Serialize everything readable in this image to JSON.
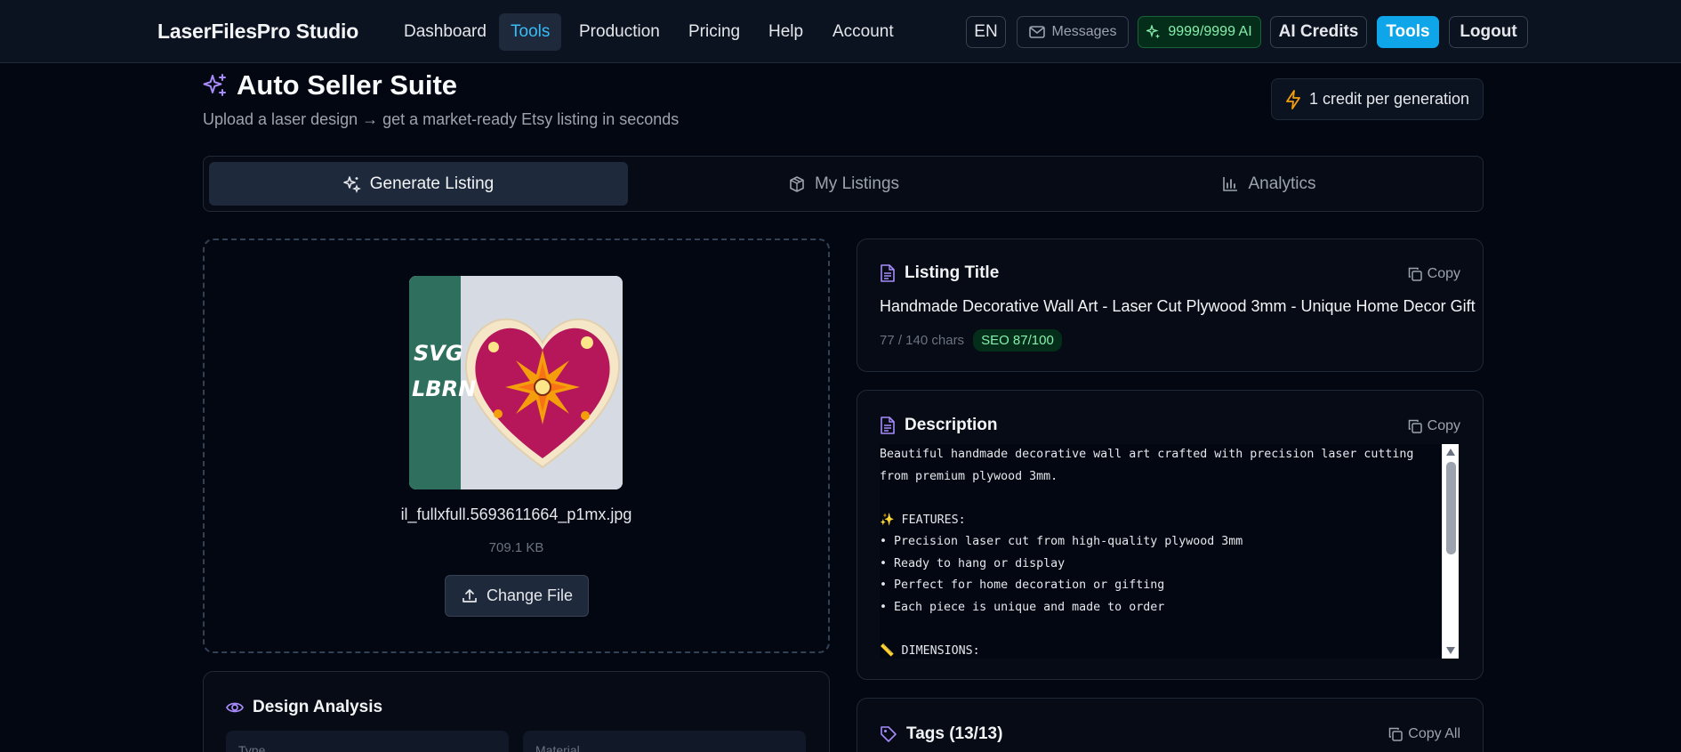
{
  "nav": {
    "brand": "LaserFilesPro Studio",
    "links": [
      "Dashboard",
      "Tools",
      "Production",
      "Pricing",
      "Help",
      "Account"
    ],
    "lang": "EN",
    "messages": "Messages",
    "ai_quota": "9999/9999 AI",
    "ai_credits": "AI Credits",
    "tools_btn": "Tools",
    "logout": "Logout"
  },
  "header": {
    "title": "Auto Seller Suite",
    "subtitle": "Upload a laser design → get a market-ready Etsy listing in seconds",
    "credit_note": "1 credit per generation"
  },
  "tabs": [
    "Generate Listing",
    "My Listings",
    "Analytics"
  ],
  "upload": {
    "thumb_text": [
      "SVG",
      "LBRN"
    ],
    "filename": "il_fullxfull.5693611664_p1mx.jpg",
    "filesize": "709.1 KB",
    "change_label": "Change File"
  },
  "analysis": {
    "title": "Design Analysis",
    "fields": [
      "Type",
      "Material"
    ]
  },
  "listing": {
    "title_label": "Listing Title",
    "copy": "Copy",
    "title_text": "Handmade Decorative Wall Art - Laser Cut Plywood 3mm - Unique Home Decor Gift",
    "chars": "77 / 140 chars",
    "seo": "SEO 87/100"
  },
  "description": {
    "label": "Description",
    "copy": "Copy",
    "body": "Beautiful handmade decorative wall art crafted with precision laser cutting from premium plywood 3mm.\n\n✨ FEATURES:\n• Precision laser cut from high-quality plywood 3mm\n• Ready to hang or display\n• Perfect for home decoration or gifting\n• Each piece is unique and made to order\n\n📏 DIMENSIONS:"
  },
  "tags": {
    "label": "Tags (13/13)",
    "copy_all": "Copy All"
  },
  "colors": {
    "accent": "#38bdf8",
    "brand_button": "#0ea5e9",
    "icon_purple": "#a78bfa",
    "seo_green": "#86efac",
    "bolt_amber": "#f59e0b"
  }
}
